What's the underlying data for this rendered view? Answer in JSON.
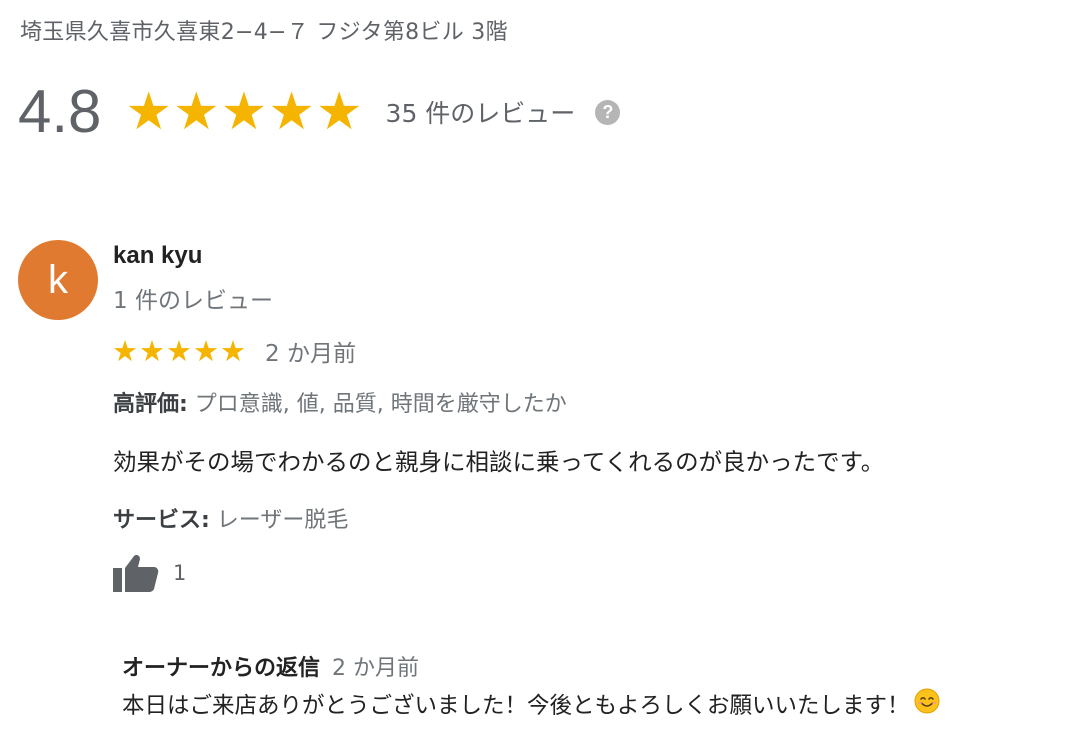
{
  "place": {
    "address": "埼玉県久喜市久喜東2−4−７ フジタ第8ビル 3階"
  },
  "rating_summary": {
    "rating": "4.8",
    "stars_filled": 5,
    "star_color": "#f4b400",
    "review_count": "35 件のレビュー",
    "help_icon_glyph": "?"
  },
  "review": {
    "avatar_letter": "k",
    "avatar_color": "#e07a30",
    "reviewer_name": "kan kyu",
    "reviewer_meta": "1 件のレビュー",
    "stars": 5,
    "date": "2 か月前",
    "highlights_label": "高評価:",
    "highlights_value": " プロ意識, 値, 品質, 時間を厳守したか",
    "text": "効果がその場でわかるのと親身に相談に乗ってくれるのが良かったです。",
    "service_label": "サービス:",
    "service_value": " レーザー脱毛",
    "like_icon": "thumbs-up-icon",
    "like_count": "1"
  },
  "owner_reply": {
    "title": "オーナーからの返信",
    "date": "2 か月前",
    "text": "本日はご来店ありがとうございました！今後ともよろしくお願いいたします！",
    "emoji_icon": "smiling-face-icon"
  }
}
